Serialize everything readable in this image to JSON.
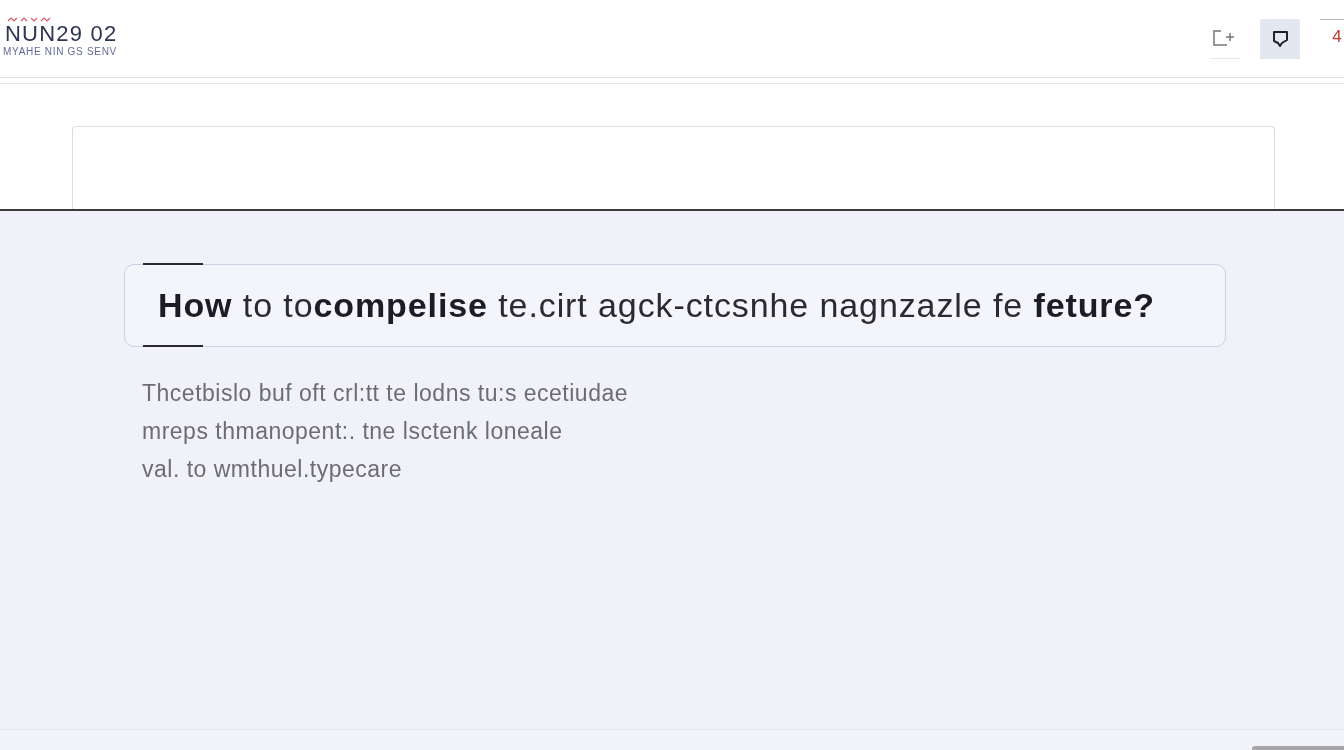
{
  "header": {
    "logo": {
      "title": "NUN29 02",
      "subtitle": "MYAHE NIN GS SENV"
    },
    "actions": [
      {
        "kind": "add-frame",
        "selected": false
      },
      {
        "kind": "chat",
        "selected": true
      }
    ],
    "badge": "4"
  },
  "question": "**How** to to**compelise** te.cirt agck-ctcsnhe nagnzazle fe **feture?**",
  "answer": [
    "Thcetbislo buf oft crl:tt te lodns tu:s ecetiudae",
    "mreps thmanopent:. tne lsctenk loneale",
    "val. to wmthuel.typecare"
  ]
}
